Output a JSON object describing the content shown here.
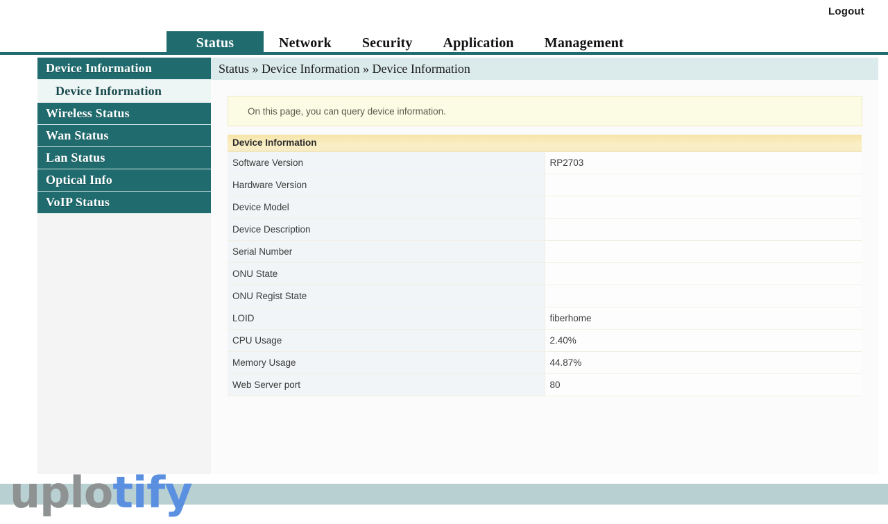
{
  "topbar": {
    "logout_label": "Logout"
  },
  "menu": {
    "items": [
      {
        "label": "Status",
        "active": true
      },
      {
        "label": "Network",
        "active": false
      },
      {
        "label": "Security",
        "active": false
      },
      {
        "label": "Application",
        "active": false
      },
      {
        "label": "Management",
        "active": false
      }
    ]
  },
  "sidebar": {
    "items": [
      {
        "label": "Device Information",
        "type": "group"
      },
      {
        "label": "Device Information",
        "type": "sub",
        "active": true
      },
      {
        "label": "Wireless Status",
        "type": "group"
      },
      {
        "label": "Wan Status",
        "type": "group"
      },
      {
        "label": "Lan Status",
        "type": "group"
      },
      {
        "label": "Optical Info",
        "type": "group"
      },
      {
        "label": "VoIP Status",
        "type": "group"
      }
    ]
  },
  "content": {
    "breadcrumb": "Status » Device Information » Device Information",
    "notice": "On this page, you can query device information.",
    "table": {
      "header": "Device Information",
      "rows": [
        {
          "label": "Software Version",
          "value": "RP2703"
        },
        {
          "label": "Hardware Version",
          "value": ""
        },
        {
          "label": "Device Model",
          "value": ""
        },
        {
          "label": "Device Description",
          "value": ""
        },
        {
          "label": "Serial Number",
          "value": ""
        },
        {
          "label": "ONU State",
          "value": ""
        },
        {
          "label": "ONU Regist State",
          "value": ""
        },
        {
          "label": "LOID",
          "value": "fiberhome"
        },
        {
          "label": "CPU Usage",
          "value": "2.40%"
        },
        {
          "label": "Memory Usage",
          "value": "44.87%"
        },
        {
          "label": "Web Server port",
          "value": "80"
        }
      ]
    }
  },
  "watermark": {
    "part_gray": "uplo",
    "part_blue": "tify"
  },
  "colors": {
    "teal": "#1f6b6e",
    "breadcrumb_band": "#dbeaea",
    "notice_bg": "#fcfbe3",
    "table_header": "#f5e4a8",
    "footer": "#b9d0d2",
    "watermark_gray": "#8f9293",
    "watermark_blue": "#5b8fe0"
  }
}
